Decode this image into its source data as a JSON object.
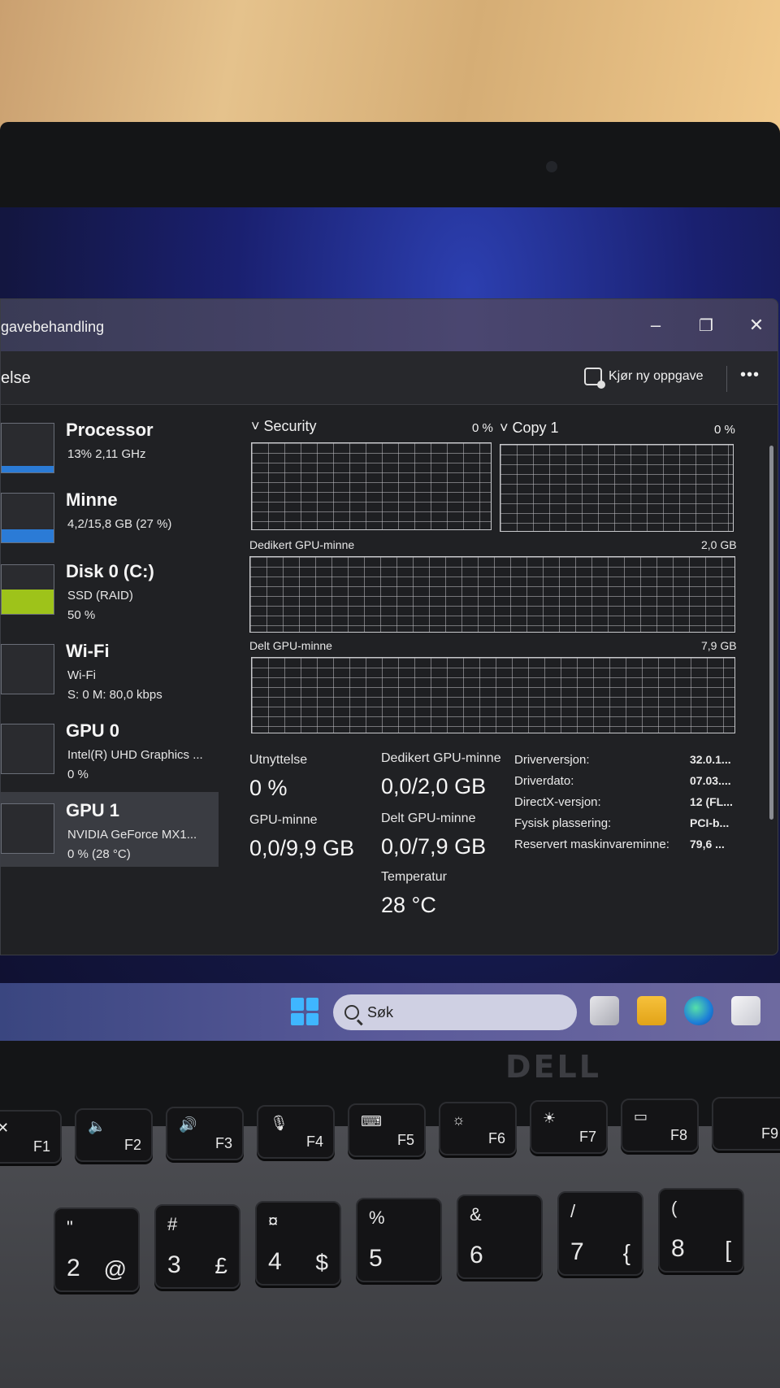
{
  "window": {
    "title": "gavebehandling",
    "minimize": "–",
    "maximize": "❐",
    "close": "✕",
    "section": "else",
    "run_task_label": "Kjør ny oppgave",
    "more_label": "•••"
  },
  "sidebar": {
    "items": [
      {
        "name": "Processor",
        "line1": "13%  2,11 GHz",
        "line2": ""
      },
      {
        "name": "Minne",
        "line1": "4,2/15,8 GB (27 %)",
        "line2": ""
      },
      {
        "name": "Disk 0 (C:)",
        "line1": "SSD (RAID)",
        "line2": "50 %"
      },
      {
        "name": "Wi-Fi",
        "line1": "Wi-Fi",
        "line2": "S: 0  M: 80,0 kbps"
      },
      {
        "name": "GPU 0",
        "line1": "Intel(R) UHD Graphics ...",
        "line2": "0 %"
      },
      {
        "name": "GPU 1",
        "line1": "NVIDIA GeForce MX1...",
        "line2": "0 % (28 °C)"
      }
    ],
    "levels": {
      "processor": 0.13,
      "memory": 0.27,
      "disk": 0.5
    }
  },
  "gpu": {
    "engine1_label": "Security",
    "engine1_pct": "0 %",
    "engine2_label": "Copy 1",
    "engine2_pct": "0 %",
    "dedicated_label": "Dedikert GPU-minne",
    "dedicated_max": "2,0 GB",
    "shared_label": "Delt GPU-minne",
    "shared_max": "7,9 GB",
    "stats": {
      "utilization_label": "Utnyttelse",
      "utilization_value": "0 %",
      "dedicated_label": "Dedikert GPU-minne",
      "dedicated_value": "0,0/2,0 GB",
      "gpu_memory_label": "GPU-minne",
      "gpu_memory_value": "0,0/9,9 GB",
      "shared_label": "Delt GPU-minne",
      "shared_value": "0,0/7,9 GB",
      "temperature_label": "Temperatur",
      "temperature_value": "28 °C"
    },
    "info": [
      {
        "label": "Driverversjon:",
        "value": "32.0.1..."
      },
      {
        "label": "Driverdato:",
        "value": "07.03...."
      },
      {
        "label": "DirectX-versjon:",
        "value": "12 (FL..."
      },
      {
        "label": "Fysisk plassering:",
        "value": "PCI-b..."
      },
      {
        "label": "Reservert maskinvareminne:",
        "value": "79,6 ..."
      }
    ]
  },
  "taskbar": {
    "search_placeholder": "Søk"
  },
  "laptop": {
    "brand": "DELL",
    "fkeys": [
      {
        "fn": "F1",
        "icon": "✕"
      },
      {
        "fn": "F2",
        "icon": "🔈"
      },
      {
        "fn": "F3",
        "icon": "🔊"
      },
      {
        "fn": "F4",
        "icon": "🎙"
      },
      {
        "fn": "F5",
        "icon": "⌨"
      },
      {
        "fn": "F6",
        "icon": "☼"
      },
      {
        "fn": "F7",
        "icon": "☀"
      },
      {
        "fn": "F8",
        "icon": "▭"
      },
      {
        "fn": "F9",
        "icon": ""
      }
    ],
    "numkeys": [
      {
        "main": "2",
        "top": "\"",
        "alt": "@"
      },
      {
        "main": "3",
        "top": "#",
        "alt": "£"
      },
      {
        "main": "4",
        "top": "¤",
        "alt": "$"
      },
      {
        "main": "5",
        "top": "%",
        "alt": ""
      },
      {
        "main": "6",
        "top": "&",
        "alt": ""
      },
      {
        "main": "7",
        "top": "/",
        "alt": "{"
      },
      {
        "main": "8",
        "top": "(",
        "alt": "["
      }
    ]
  },
  "colors": {
    "processor_fill": "#2b7bd6",
    "memory_fill": "#2b7bd6",
    "disk_fill": "#9ec31a",
    "windows_blue": "#3fb6ff"
  }
}
